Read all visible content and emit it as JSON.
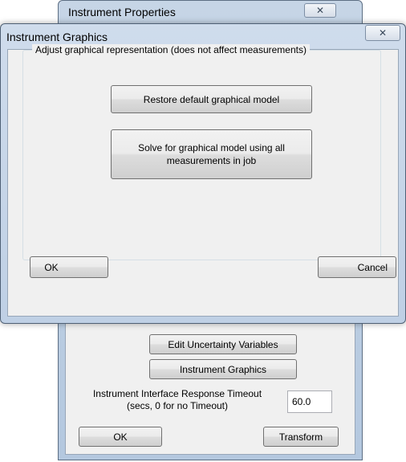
{
  "background_dialog": {
    "title": "Instrument Properties",
    "close_glyph": "✕",
    "buttons": {
      "edit_uncertainty": "Edit Uncertainty Variables",
      "instrument_graphics": "Instrument Graphics",
      "ok": "OK",
      "transform": "Transform"
    },
    "timeout": {
      "label_line1": "Instrument Interface Response Timeout",
      "label_line2": "(secs, 0 for no Timeout)",
      "value": "60.0"
    }
  },
  "dialog": {
    "title": "Instrument Graphics",
    "close_glyph": "✕",
    "group_label": "Adjust graphical representation (does not affect measurements)",
    "buttons": {
      "restore": "Restore default graphical model",
      "solve_line1": "Solve for graphical model using all",
      "solve_line2": "measurements in job",
      "ok": "OK",
      "cancel": "Cancel"
    }
  }
}
